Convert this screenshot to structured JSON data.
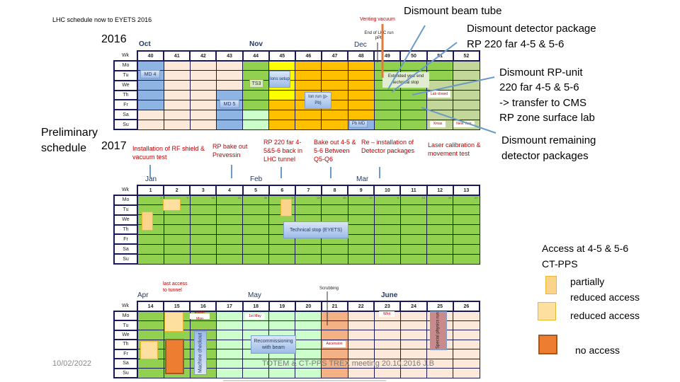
{
  "header": {
    "title": "LHC schedule now to EYETS 2016",
    "year_2016": "2016",
    "schedule_label_line1": "Preliminary",
    "schedule_label_line2": "schedule",
    "year_2017": "2017"
  },
  "cal2016": {
    "months": {
      "oct": "Oct",
      "nov": "Nov",
      "dec": "Dec"
    },
    "wk_label": "Wk",
    "weeks": [
      "40",
      "41",
      "42",
      "43",
      "44",
      "45",
      "46",
      "47",
      "48",
      "49",
      "50",
      "51",
      "52"
    ],
    "days": [
      "Mo",
      "Tu",
      "We",
      "Th",
      "Fr",
      "Sa",
      "Su"
    ],
    "events": {
      "md4": "MD 4",
      "md5": "MD 5",
      "ts3": "TS3",
      "ions_setup": "Ions setup",
      "ion_run": "Ion run (p-Pb)",
      "pb_md": "Pb MD",
      "eyets": "Extended year end technical stop",
      "lab_closed": "Lab closed",
      "xmas": "Xmas",
      "new_year": "New Year"
    },
    "annotations": {
      "venting": "Venting vacuum",
      "end_run": "End of LHC run pPb"
    }
  },
  "cal2017a": {
    "months": {
      "jan": "Jan",
      "feb": "Feb",
      "mar": "Mar"
    },
    "wk_label": "Wk",
    "weeks": [
      "1",
      "2",
      "3",
      "4",
      "5",
      "6",
      "7",
      "8",
      "9",
      "10",
      "11",
      "12",
      "13"
    ],
    "days": [
      "Mo",
      "Tu",
      "We",
      "Th",
      "Fr",
      "Sa",
      "Su"
    ],
    "day_numbers": [
      "2",
      "9",
      "16",
      "23",
      "30",
      "6",
      "13",
      "20",
      "27",
      "6",
      "13",
      "20",
      "27"
    ],
    "tech_stop": "Technical stop (EYETS)"
  },
  "cal2017b": {
    "months": {
      "apr": "Apr",
      "may": "May",
      "june": "June"
    },
    "wk_label": "Wk",
    "weeks": [
      "14",
      "15",
      "16",
      "17",
      "18",
      "19",
      "20",
      "21",
      "22",
      "23",
      "24",
      "25",
      "26"
    ],
    "days": [
      "Mo",
      "Tu",
      "We",
      "Th",
      "Fr",
      "Sa",
      "Su"
    ],
    "last_access": "last access to tunnel",
    "scrubbing": "Scrubbing",
    "machine_checkout": "Machine checkout",
    "recommissioning": "Recommissioning with beam",
    "easter": "Easter Mon",
    "may1": "1st May",
    "whit": "Whit",
    "ascension": "Ascension",
    "special_physics": "Special physics run"
  },
  "annotations2017": {
    "rf_shield": "Installation of RF shield & vacuum test",
    "bake_prevessin": "RP bake out Prevessin",
    "rp220_back": "RP 220 far 4-5&5-6 back in LHC tunnel",
    "bake_q5q6": "Bake out 4-5 & 5-6 Between Q5-Q6",
    "reinstall": "Re – installation of Detector packages",
    "laser": "Laser calibration & movement test"
  },
  "right_notes": {
    "beam_tube": "Dismount beam tube",
    "det_pkg_1": "Dismount detector package",
    "det_pkg_2": "RP 220 far 4-5 & 5-6",
    "rp_unit_1": "Dismount RP-unit",
    "rp_unit_2": "220 far 4-5 & 5-6",
    "rp_unit_3": "-> transfer  to CMS",
    "rp_unit_4": "RP zone surface lab",
    "remaining_1": "Dismount remaining",
    "remaining_2": "detector packages"
  },
  "legend": {
    "title_1": "Access at 4-5 & 5-6",
    "title_2": "CT-PPS",
    "partial_1": "partially",
    "partial_2": "reduced access",
    "reduced": "reduced access",
    "none": "no access",
    "colors": {
      "partial": "#fcd38a",
      "reduced": "#fde0a0",
      "none": "#ed7d31"
    }
  },
  "footer": {
    "date": "10/02/2022",
    "meeting": "TOTEM & CT-PPS TREX meeting 20.10.2016   J.B"
  }
}
